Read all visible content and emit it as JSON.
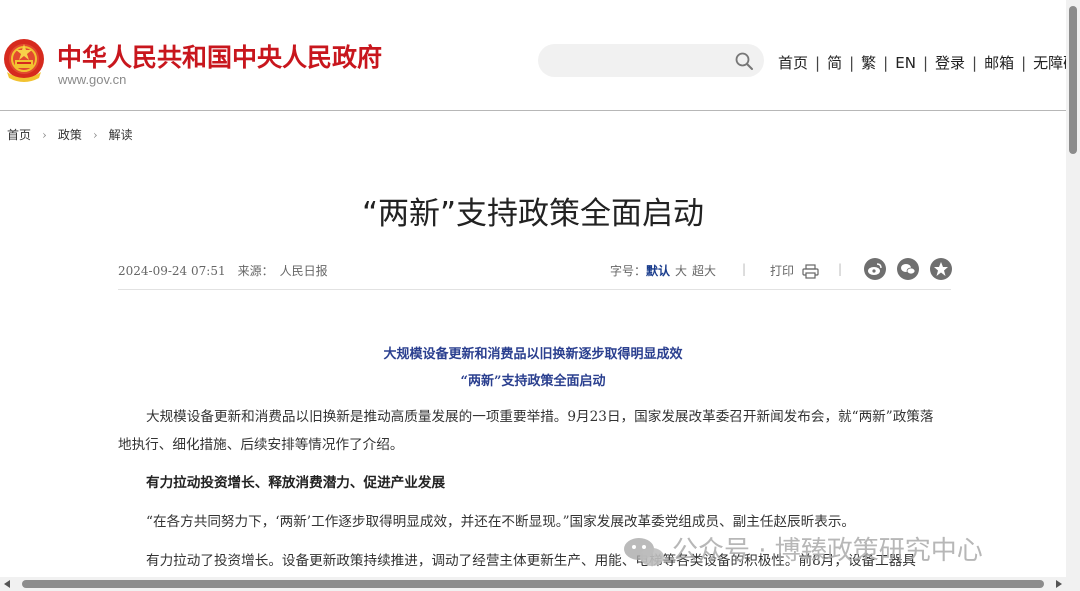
{
  "header": {
    "site_name": "中华人民共和国中央人民政府",
    "site_url": "www.gov.cn",
    "emblem_icon": "national-emblem-icon",
    "search": {
      "placeholder": "",
      "icon": "search-icon"
    },
    "nav": [
      "首页",
      "简",
      "繁",
      "EN",
      "登录",
      "邮箱",
      "无障碍"
    ],
    "nav_separator": "|"
  },
  "breadcrumb": [
    "首页",
    "政策",
    "解读"
  ],
  "article": {
    "title": "“两新”支持政策全面启动",
    "date": "2024-09-24 07:51",
    "source_label": "来源：",
    "source": "人民日报",
    "fontsize_label": "字号：",
    "fontsize_options": [
      "默认",
      "大",
      "超大"
    ],
    "fontsize_selected": "默认",
    "print_label": "打印",
    "share_icons": [
      "weibo-icon",
      "wechat-icon",
      "favorite-icon"
    ],
    "subheads": [
      "大规模设备更新和消费品以旧换新逐步取得明显成效",
      "“两新”支持政策全面启动"
    ],
    "paragraphs": [
      "大规模设备更新和消费品以旧换新是推动高质量发展的一项重要举措。9月23日，国家发展改革委召开新闻发布会，就“两新”政策落地执行、细化措施、后续安排等情况作了介绍。",
      "有力拉动投资增长、释放消费潜力、促进产业发展",
      "“在各方共同努力下，‘两新’工作逐步取得明显成效，并还在不断显现。”国家发展改革委党组成员、副主任赵辰昕表示。",
      "有力拉动了投资增长。设备更新政策持续推进，调动了经营主体更新生产、用能、电梯等各类设备的积极性。前8月，设备工器具"
    ]
  },
  "watermark": "公众号 · 博臻政策研究中心",
  "colors": {
    "brand_red": "#c8161d",
    "subhead_blue": "#2a3f8f",
    "active_fontsize": "#1a3c8c"
  }
}
